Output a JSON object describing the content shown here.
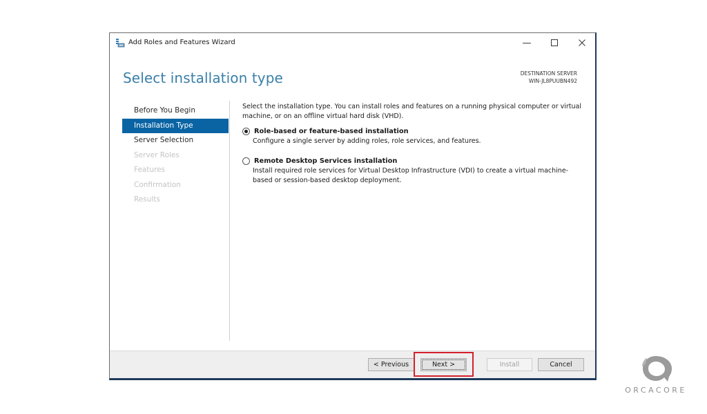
{
  "window": {
    "title": "Add Roles and Features Wizard",
    "controls": {
      "minimize": "—",
      "maximize": "☐",
      "close": "✕"
    }
  },
  "header": {
    "page_title": "Select installation type",
    "destination_label": "DESTINATION SERVER",
    "destination_server": "WIN-JL8PUUBN492"
  },
  "nav": {
    "items": [
      {
        "label": "Before You Begin",
        "state": "enabled"
      },
      {
        "label": "Installation Type",
        "state": "active"
      },
      {
        "label": "Server Selection",
        "state": "enabled"
      },
      {
        "label": "Server Roles",
        "state": "disabled"
      },
      {
        "label": "Features",
        "state": "disabled"
      },
      {
        "label": "Confirmation",
        "state": "disabled"
      },
      {
        "label": "Results",
        "state": "disabled"
      }
    ]
  },
  "content": {
    "intro": "Select the installation type. You can install roles and features on a running physical computer or virtual machine, or on an offline virtual hard disk (VHD).",
    "options": [
      {
        "label": "Role-based or feature-based installation",
        "description": "Configure a single server by adding roles, role services, and features.",
        "selected": true
      },
      {
        "label": "Remote Desktop Services installation",
        "description": "Install required role services for Virtual Desktop Infrastructure (VDI) to create a virtual machine-based or session-based desktop deployment.",
        "selected": false
      }
    ]
  },
  "footer": {
    "previous": "< Previous",
    "next": "Next >",
    "install": "Install",
    "cancel": "Cancel"
  },
  "watermark": {
    "text": "ORCACORE"
  },
  "colors": {
    "accent": "#0a64a4",
    "title": "#3a7fa8",
    "highlight": "#d4202a"
  }
}
